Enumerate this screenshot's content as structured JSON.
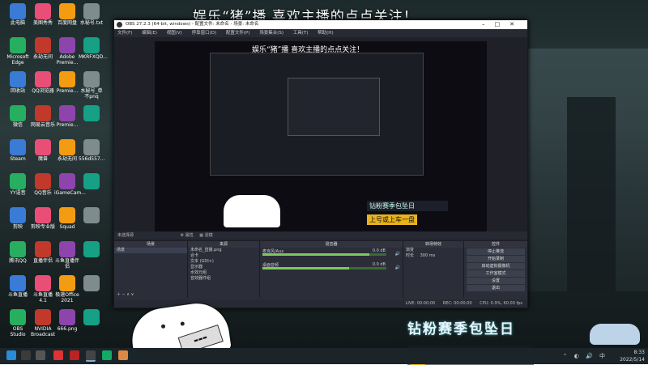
{
  "overlay": {
    "title": "娱乐“猪”播 喜欢主播的点点关注！",
    "promo_line1": "钻粉赛季包坠日",
    "promo_line2": "上号或上车一盘"
  },
  "desktop_icons": [
    {
      "label": "此电脑"
    },
    {
      "label": "美图秀秀"
    },
    {
      "label": "百度网盘"
    },
    {
      "label": "水秘号.txt"
    },
    {
      "label": "Microsoft Edge"
    },
    {
      "label": "永劫无间"
    },
    {
      "label": "Adobe Premie..."
    },
    {
      "label": "MKRFXQD..."
    },
    {
      "label": "回收站"
    },
    {
      "label": "QQ浏览器"
    },
    {
      "label": "Premie..."
    },
    {
      "label": "水秘号_单不pnq"
    },
    {
      "label": "微信"
    },
    {
      "label": "网易云音乐"
    },
    {
      "label": "Premie..."
    },
    {
      "label": ""
    },
    {
      "label": "Steam"
    },
    {
      "label": "魔兽"
    },
    {
      "label": "永劫无间"
    },
    {
      "label": "556d557..."
    },
    {
      "label": "YY语音"
    },
    {
      "label": "QQ音乐"
    },
    {
      "label": "iGameCam..."
    },
    {
      "label": ""
    },
    {
      "label": "剪映"
    },
    {
      "label": "剪映专业版"
    },
    {
      "label": "Squad"
    },
    {
      "label": ""
    },
    {
      "label": "腾讯QQ"
    },
    {
      "label": "直播伴侣"
    },
    {
      "label": "斗鱼直播伴侣"
    },
    {
      "label": ""
    },
    {
      "label": "斗鱼直播"
    },
    {
      "label": "斗鱼直播4.1"
    },
    {
      "label": "极速Office 2021"
    },
    {
      "label": ""
    },
    {
      "label": "OBS Studio"
    },
    {
      "label": "NVIDIA Broadcast"
    },
    {
      "label": "666.png"
    },
    {
      "label": ""
    }
  ],
  "obs": {
    "title": "OBS 27.2.3 (64-bit, windows) - 配置文件: 未命名 - 场景: 未命名",
    "menu": [
      "文件(F)",
      "编辑(E)",
      "视图(V)",
      "停靠窗口(D)",
      "配置文件(P)",
      "场景集合(S)",
      "工具(T)",
      "帮助(H)"
    ],
    "source_bar": "未选择源",
    "properties": "属性",
    "filters": "滤镜",
    "docks": {
      "scenes": {
        "header": "场景",
        "items": [
          "场景"
        ]
      },
      "sources": {
        "header": "来源",
        "items": [
          "未命名_直播.png",
          "合卡",
          "文本 (GDI+)",
          "显示器",
          "水效元组",
          "音效器件组"
        ]
      },
      "mixer": {
        "header": "混音器",
        "tracks": [
          {
            "name": "麦克风/Aux",
            "db": "0.0 dB",
            "level": 0.86
          },
          {
            "name": "桌面音频",
            "db": "0.0 dB",
            "level": 0.7
          }
        ]
      },
      "transitions": {
        "header": "转场特效",
        "type": "渐变",
        "duration_label": "时长",
        "duration": "300 ms"
      },
      "controls": {
        "header": "控件",
        "buttons": [
          "停止推流",
          "开始录制",
          "启动虚拟摄像机",
          "工作室模式",
          "设置",
          "退出"
        ]
      }
    },
    "status": {
      "live": "LIVE: 00:00:00",
      "rec": "REC: 00:00:00",
      "cpu": "CPU: 0.9%, 60.00 fps"
    }
  },
  "taskbar": {
    "time": "8:33",
    "date": "2022/5/14"
  },
  "colors": {
    "obs_bg": "#2b2e38",
    "accent_red": "#ff4b4b",
    "accent_gold": "#e9b21e"
  }
}
